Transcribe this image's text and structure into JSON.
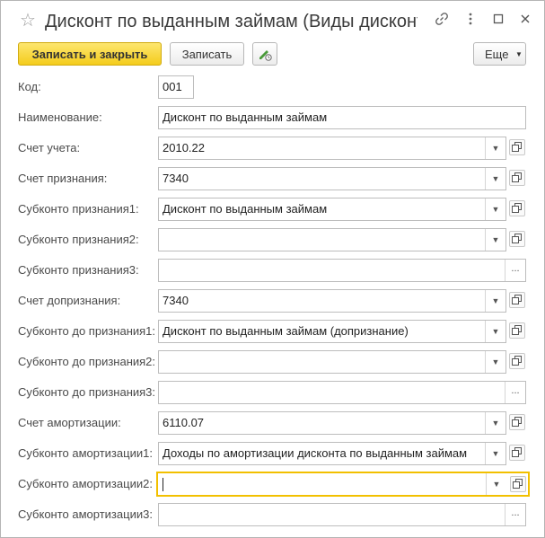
{
  "window": {
    "title": "Дисконт по выданным займам (Виды дисконт..."
  },
  "toolbar": {
    "save_close_label": "Записать и закрыть",
    "save_label": "Записать",
    "more_label": "Еще"
  },
  "form": {
    "code": {
      "label": "Код:",
      "value": "001"
    },
    "name": {
      "label": "Наименование:",
      "value": "Дисконт по выданным займам"
    },
    "fields": [
      {
        "label": "Счет учета:",
        "value": "2010.22",
        "kind": "select"
      },
      {
        "label": "Счет признания:",
        "value": "7340",
        "kind": "select"
      },
      {
        "label": "Субконто признания1:",
        "value": "Дисконт по выданным займам",
        "kind": "select"
      },
      {
        "label": "Субконто признания2:",
        "value": "",
        "kind": "select"
      },
      {
        "label": "Субконто признания3:",
        "value": "",
        "kind": "choice"
      },
      {
        "label": "Счет допризнания:",
        "value": "7340",
        "kind": "select"
      },
      {
        "label": "Субконто до признания1:",
        "value": "Дисконт по выданным займам (допризнание)",
        "kind": "select"
      },
      {
        "label": "Субконто до признания2:",
        "value": "",
        "kind": "select"
      },
      {
        "label": "Субконто до признания3:",
        "value": "",
        "kind": "choice"
      },
      {
        "label": "Счет амортизации:",
        "value": "6110.07",
        "kind": "select"
      },
      {
        "label": "Субконто амортизации1:",
        "value": "Доходы по амортизации дисконта по выданным займам",
        "kind": "select"
      },
      {
        "label": "Субконто амортизации2:",
        "value": "",
        "kind": "select"
      },
      {
        "label": "Субконто амортизации3:",
        "value": "",
        "kind": "choice"
      }
    ]
  },
  "icons": {
    "favorite": "star-icon",
    "link": "link-icon",
    "more_options": "kebab-menu-icon",
    "maximize": "maximize-icon",
    "close": "close-icon",
    "edit_history": "pencil-clock-icon",
    "open": "open-in-window-icon"
  },
  "colors": {
    "primary_button": "#f4cc1c",
    "active_field_border": "#f2c000"
  }
}
